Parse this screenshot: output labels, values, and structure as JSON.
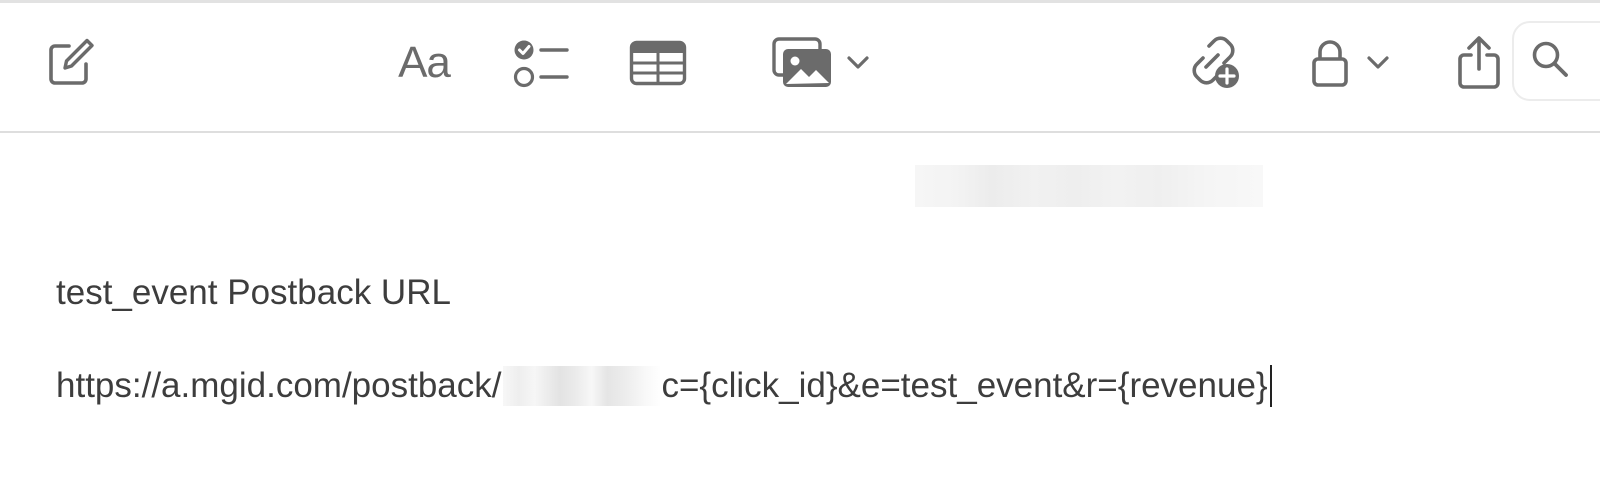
{
  "toolbar": {
    "compose_icon": "compose-icon",
    "format_label": "Aa",
    "checklist_icon": "checklist-icon",
    "table_icon": "table-icon",
    "media_icon": "photo-gallery-icon",
    "collaborate_icon": "link-add-icon",
    "lock_icon": "lock-icon",
    "share_icon": "share-icon",
    "search_icon": "search-icon"
  },
  "note": {
    "title": "test_event Postback URL",
    "url_prefix": "https://a.mgid.com/postback/",
    "url_suffix": "c={click_id}&e=test_event&r={revenue}"
  },
  "colors": {
    "icon": "#6b6b6b",
    "text": "#3d3d3d",
    "divider": "#dedede"
  }
}
